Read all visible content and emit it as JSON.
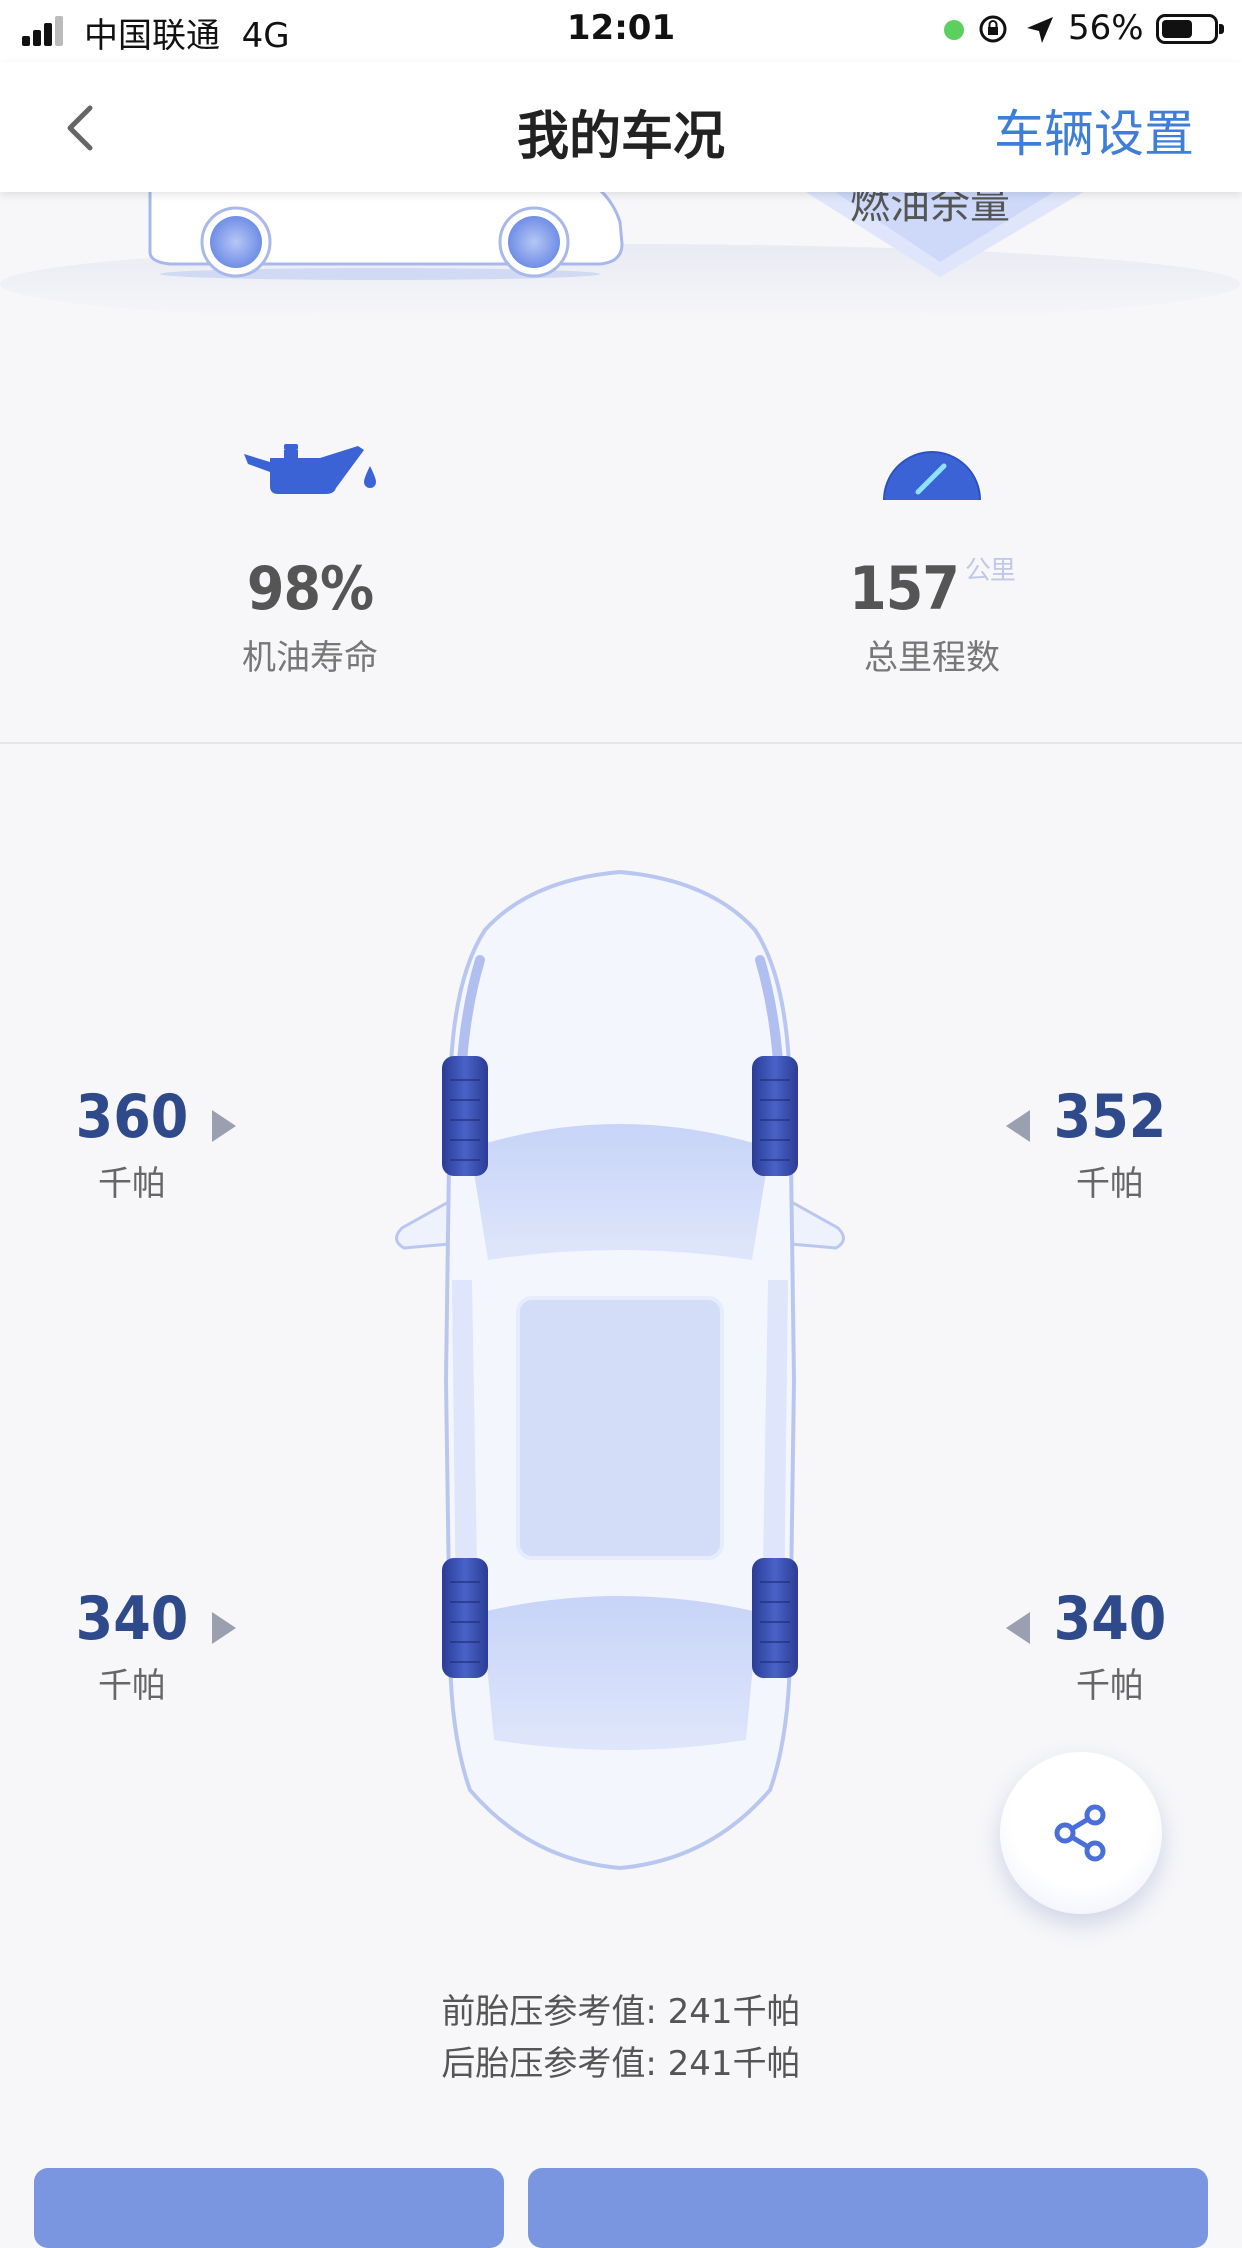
{
  "status_bar": {
    "carrier": "中国联通",
    "network": "4G",
    "time": "12:01",
    "battery": "56%"
  },
  "nav": {
    "title": "我的车况",
    "action": "车辆设置"
  },
  "top_banner": {
    "fuel_label": "燃油余量"
  },
  "stats": {
    "oil_life": {
      "value": "98%",
      "label": "机油寿命",
      "icon": "oil-can-icon"
    },
    "mileage": {
      "value": "157",
      "unit": "公里",
      "label": "总里程数",
      "icon": "speedometer-icon"
    }
  },
  "tires": {
    "front_left": {
      "value": "360",
      "unit": "千帕"
    },
    "front_right": {
      "value": "352",
      "unit": "千帕"
    },
    "rear_left": {
      "value": "340",
      "unit": "千帕"
    },
    "rear_right": {
      "value": "340",
      "unit": "千帕"
    }
  },
  "reference": {
    "front": "前胎压参考值: 241千帕",
    "rear": "后胎压参考值: 241千帕"
  },
  "colors": {
    "accent": "#3f7ed8",
    "tire_value": "#2e4a8a",
    "icon_blue": "#3b63d6"
  }
}
